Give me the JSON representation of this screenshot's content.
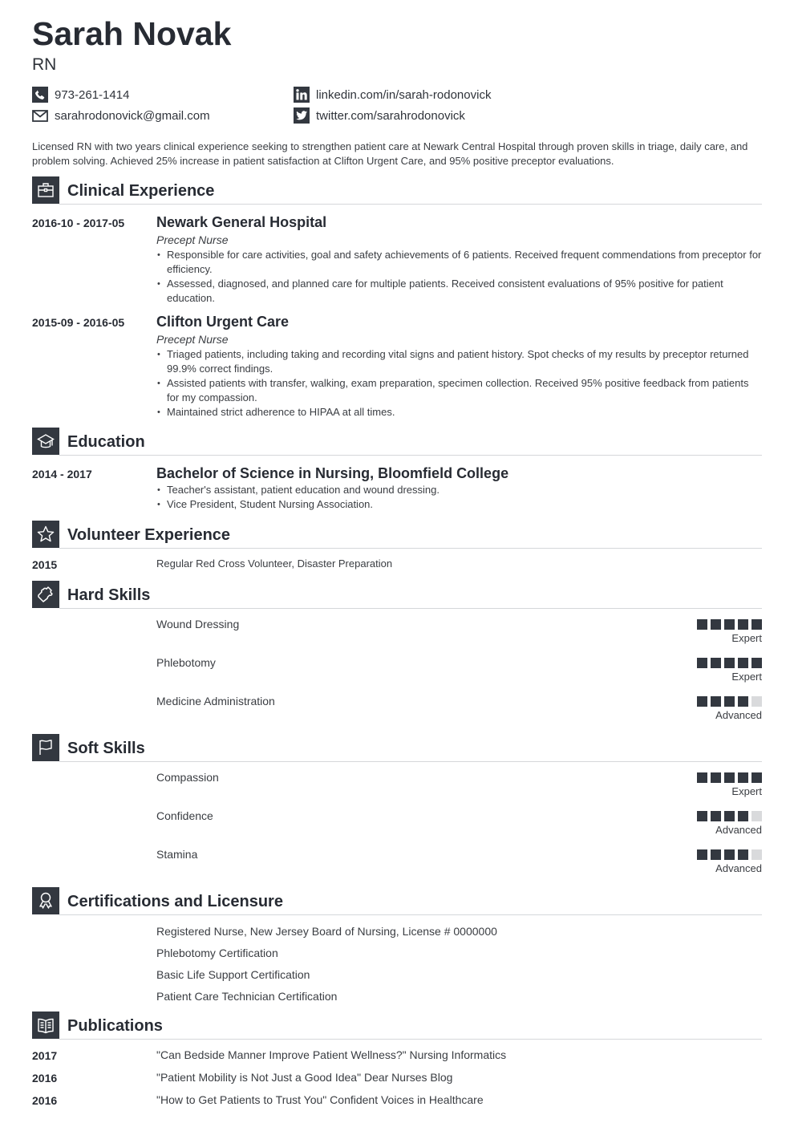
{
  "header": {
    "name": "Sarah Novak",
    "title": "RN"
  },
  "contact": {
    "phone": "973-261-1414",
    "email": "sarahrodonovick@gmail.com",
    "linkedin": "linkedin.com/in/sarah-rodonovick",
    "twitter": "twitter.com/sarahrodonovick"
  },
  "summary": "Licensed RN with two years clinical experience seeking to strengthen patient care at Newark Central Hospital through proven skills in triage, daily care, and problem solving. Achieved 25% increase in patient satisfaction at Clifton Urgent Care, and 95% positive preceptor evaluations.",
  "sections": {
    "clinical": {
      "title": "Clinical Experience",
      "icon": "briefcase-icon"
    },
    "education": {
      "title": "Education",
      "icon": "graduation-cap-icon"
    },
    "volunteer": {
      "title": "Volunteer Experience",
      "icon": "star-icon"
    },
    "hard_skills": {
      "title": "Hard Skills",
      "icon": "puzzle-icon"
    },
    "soft_skills": {
      "title": "Soft Skills",
      "icon": "flag-icon"
    },
    "certifications": {
      "title": "Certifications and Licensure",
      "icon": "award-ribbon-icon"
    },
    "publications": {
      "title": "Publications",
      "icon": "book-icon"
    }
  },
  "experience": [
    {
      "dates": "2016-10 - 2017-05",
      "organization": "Newark General Hospital",
      "role": "Precept Nurse",
      "bullets": [
        "Responsible for care activities, goal and safety achievements of 6 patients. Received frequent commendations from preceptor for efficiency.",
        "Assessed, diagnosed, and planned care for multiple patients. Received consistent evaluations of 95% positive for patient education."
      ]
    },
    {
      "dates": "2015-09 - 2016-05",
      "organization": "Clifton Urgent Care",
      "role": "Precept Nurse",
      "bullets": [
        "Triaged patients, including taking and recording vital signs and patient history. Spot checks of my results by preceptor returned 99.9% correct findings.",
        "Assisted patients with transfer, walking, exam preparation, specimen collection. Received 95% positive feedback from patients for my compassion.",
        "Maintained strict adherence to HIPAA at all times."
      ]
    }
  ],
  "education": [
    {
      "dates": "2014 - 2017",
      "degree": "Bachelor of Science in Nursing, Bloomfield College",
      "bullets": [
        "Teacher's assistant, patient education and wound dressing.",
        "Vice President, Student Nursing Association."
      ]
    }
  ],
  "volunteer": [
    {
      "year": "2015",
      "description": "Regular Red Cross Volunteer, Disaster Preparation"
    }
  ],
  "hard_skills": [
    {
      "name": "Wound Dressing",
      "level": "Expert",
      "rating": 5,
      "max": 5
    },
    {
      "name": "Phlebotomy",
      "level": "Expert",
      "rating": 5,
      "max": 5
    },
    {
      "name": "Medicine Administration",
      "level": "Advanced",
      "rating": 4,
      "max": 5
    }
  ],
  "soft_skills": [
    {
      "name": "Compassion",
      "level": "Expert",
      "rating": 5,
      "max": 5
    },
    {
      "name": "Confidence",
      "level": "Advanced",
      "rating": 4,
      "max": 5
    },
    {
      "name": "Stamina",
      "level": "Advanced",
      "rating": 4,
      "max": 5
    }
  ],
  "certifications": [
    "Registered Nurse, New Jersey Board of Nursing, License # 0000000",
    "Phlebotomy Certification",
    "Basic Life Support Certification",
    "Patient Care Technician Certification"
  ],
  "publications": [
    {
      "year": "2017",
      "title": "\"Can Bedside Manner Improve Patient Wellness?\" Nursing Informatics"
    },
    {
      "year": "2016",
      "title": "\"Patient Mobility is Not Just a Good Idea\" Dear Nurses Blog"
    },
    {
      "year": "2016",
      "title": "\"How to Get Patients to Trust You\" Confident Voices in Healthcare"
    }
  ],
  "colors": {
    "accent": "#333840",
    "heading": "#272b33",
    "text": "#3a3d42",
    "rule": "#d5d7da",
    "rating_off": "#d9dadc"
  }
}
